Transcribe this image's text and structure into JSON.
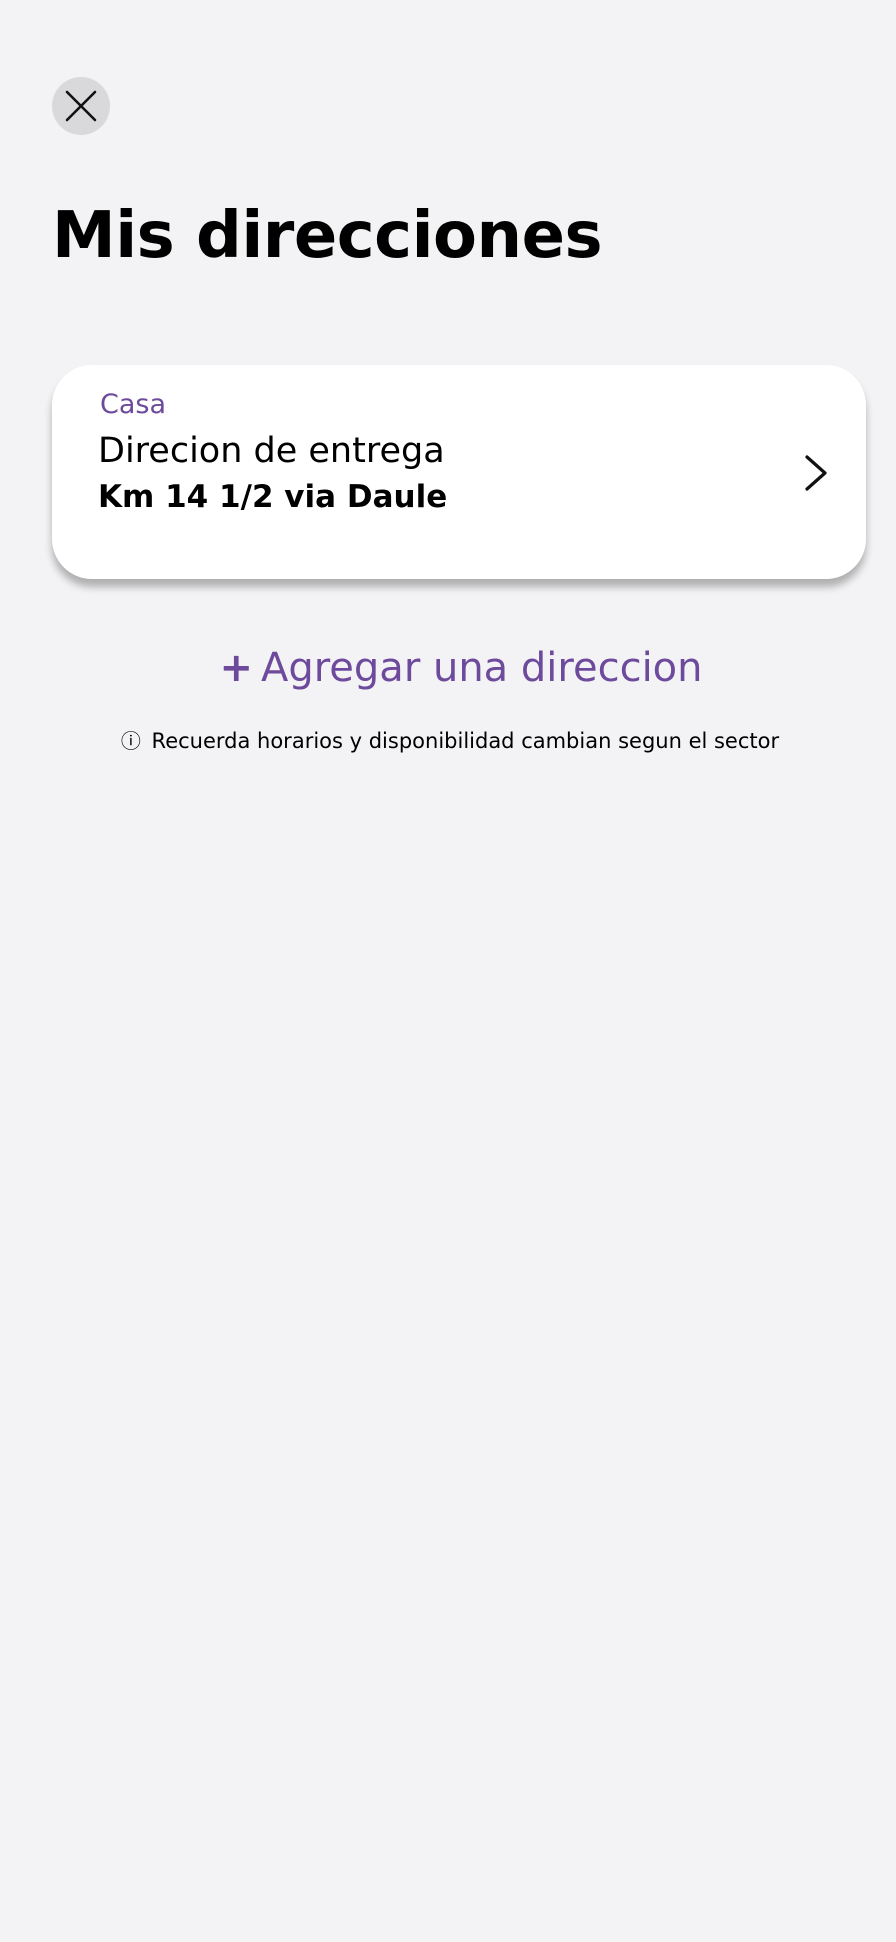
{
  "header": {
    "close_icon": "close-icon",
    "title": "Mis direcciones"
  },
  "addresses": [
    {
      "label": "Casa",
      "subtitle": "Direcion de entrega",
      "address": "Km 14 1/2 via Daule",
      "chevron_icon": "chevron-right-icon"
    }
  ],
  "actions": {
    "add_plus": "+",
    "add_label": "Agregar una direccion"
  },
  "notice": {
    "icon_glyph": "ⓘ",
    "text": "Recuerda horarios y disponibilidad cambian segun el sector"
  },
  "colors": {
    "accent": "#6e4a9c",
    "background": "#f3f3f5",
    "card": "#ffffff",
    "close_button_bg": "#d9d9db"
  }
}
